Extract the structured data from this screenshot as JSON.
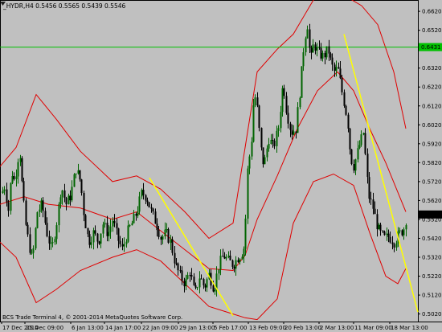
{
  "window": {
    "symbol_line": "_HYDR,H4  0.5456 0.5565 0.5439 0.5546",
    "copyright": "BCS Trade Terminal 4, © 2001-2014 MetaQuotes Software Corp."
  },
  "colors": {
    "background": "#c0c0c0",
    "bull_candle": "#006400",
    "bear_candle": "#000000",
    "bollinger": "#e00000",
    "trendline": "#ffff00",
    "hline": "#00c000",
    "last_price_tag": "#000000"
  },
  "price_axis": {
    "labels": [
      "0.6620",
      "0.6520",
      "0.6420",
      "0.6320",
      "0.6220",
      "0.6120",
      "0.6020",
      "0.5920",
      "0.5820",
      "0.5720",
      "0.5620",
      "0.5520",
      "0.5420",
      "0.5320",
      "0.5220",
      "0.5120",
      "0.5020"
    ],
    "hline_tag": "0.6431",
    "last_price_tag": "0.5546"
  },
  "time_axis": {
    "labels": [
      "17 Dec 2014",
      "25 Dec 09:00",
      "6 Jan 13:00",
      "14 Jan 17:00",
      "22 Jan 09:00",
      "29 Jan 13:00",
      "5 Feb 17:00",
      "13 Feb 09:00",
      "20 Feb 13:00",
      "2 Mar 13:00",
      "11 Mar 09:00",
      "18 Mar 13:00"
    ]
  },
  "chart_data": {
    "type": "candlestick",
    "symbol": "_HYDR",
    "timeframe": "H4",
    "ohlc_last": {
      "open": 0.5456,
      "high": 0.5565,
      "low": 0.5439,
      "close": 0.5546
    },
    "ylim": [
      0.5,
      0.668
    ],
    "horizontal_line": 0.6431,
    "price_path": [
      [
        0,
        0.564
      ],
      [
        6,
        0.57
      ],
      [
        10,
        0.556
      ],
      [
        14,
        0.578
      ],
      [
        18,
        0.572
      ],
      [
        24,
        0.59
      ],
      [
        28,
        0.565
      ],
      [
        32,
        0.548
      ],
      [
        36,
        0.538
      ],
      [
        40,
        0.53
      ],
      [
        46,
        0.556
      ],
      [
        52,
        0.56
      ],
      [
        58,
        0.545
      ],
      [
        64,
        0.535
      ],
      [
        70,
        0.55
      ],
      [
        76,
        0.57
      ],
      [
        82,
        0.56
      ],
      [
        88,
        0.565
      ],
      [
        94,
        0.579
      ],
      [
        100,
        0.572
      ],
      [
        104,
        0.555
      ],
      [
        110,
        0.54
      ],
      [
        116,
        0.545
      ],
      [
        122,
        0.54
      ],
      [
        128,
        0.55
      ],
      [
        134,
        0.544
      ],
      [
        140,
        0.552
      ],
      [
        146,
        0.542
      ],
      [
        152,
        0.536
      ],
      [
        158,
        0.545
      ],
      [
        164,
        0.55
      ],
      [
        170,
        0.556
      ],
      [
        176,
        0.566
      ],
      [
        182,
        0.564
      ],
      [
        188,
        0.556
      ],
      [
        194,
        0.55
      ],
      [
        200,
        0.542
      ],
      [
        206,
        0.545
      ],
      [
        212,
        0.54
      ],
      [
        218,
        0.528
      ],
      [
        224,
        0.522
      ],
      [
        230,
        0.518
      ],
      [
        236,
        0.525
      ],
      [
        242,
        0.512
      ],
      [
        248,
        0.522
      ],
      [
        254,
        0.516
      ],
      [
        260,
        0.523
      ],
      [
        266,
        0.515
      ],
      [
        272,
        0.528
      ],
      [
        278,
        0.533
      ],
      [
        284,
        0.53
      ],
      [
        290,
        0.528
      ],
      [
        296,
        0.532
      ],
      [
        300,
        0.534
      ],
      [
        304,
        0.538
      ],
      [
        308,
        0.58
      ],
      [
        312,
        0.59
      ],
      [
        316,
        0.62
      ],
      [
        320,
        0.61
      ],
      [
        324,
        0.59
      ],
      [
        328,
        0.58
      ],
      [
        334,
        0.595
      ],
      [
        340,
        0.59
      ],
      [
        346,
        0.6
      ],
      [
        352,
        0.625
      ],
      [
        356,
        0.61
      ],
      [
        362,
        0.598
      ],
      [
        368,
        0.6
      ],
      [
        374,
        0.625
      ],
      [
        378,
        0.645
      ],
      [
        382,
        0.656
      ],
      [
        386,
        0.635
      ],
      [
        390,
        0.645
      ],
      [
        396,
        0.64
      ],
      [
        402,
        0.638
      ],
      [
        408,
        0.642
      ],
      [
        412,
        0.634
      ],
      [
        416,
        0.63
      ],
      [
        420,
        0.632
      ],
      [
        426,
        0.618
      ],
      [
        432,
        0.605
      ],
      [
        436,
        0.585
      ],
      [
        440,
        0.58
      ],
      [
        446,
        0.59
      ],
      [
        452,
        0.598
      ],
      [
        458,
        0.565
      ],
      [
        464,
        0.558
      ],
      [
        468,
        0.55
      ],
      [
        472,
        0.545
      ],
      [
        478,
        0.542
      ],
      [
        484,
        0.543
      ],
      [
        490,
        0.54
      ],
      [
        496,
        0.544
      ],
      [
        502,
        0.547
      ],
      [
        506,
        0.5546
      ]
    ],
    "bands": {
      "upper": [
        [
          0,
          0.58
        ],
        [
          20,
          0.59
        ],
        [
          45,
          0.618
        ],
        [
          70,
          0.605
        ],
        [
          100,
          0.588
        ],
        [
          140,
          0.572
        ],
        [
          170,
          0.575
        ],
        [
          200,
          0.568
        ],
        [
          230,
          0.556
        ],
        [
          260,
          0.542
        ],
        [
          290,
          0.55
        ],
        [
          305,
          0.59
        ],
        [
          320,
          0.63
        ],
        [
          345,
          0.642
        ],
        [
          365,
          0.65
        ],
        [
          390,
          0.668
        ],
        [
          410,
          0.672
        ],
        [
          430,
          0.67
        ],
        [
          450,
          0.665
        ],
        [
          470,
          0.655
        ],
        [
          490,
          0.63
        ],
        [
          505,
          0.6
        ]
      ],
      "middle": [
        [
          0,
          0.56
        ],
        [
          30,
          0.564
        ],
        [
          60,
          0.56
        ],
        [
          100,
          0.558
        ],
        [
          140,
          0.552
        ],
        [
          170,
          0.556
        ],
        [
          200,
          0.546
        ],
        [
          230,
          0.536
        ],
        [
          260,
          0.526
        ],
        [
          290,
          0.525
        ],
        [
          305,
          0.533
        ],
        [
          320,
          0.552
        ],
        [
          345,
          0.575
        ],
        [
          370,
          0.6
        ],
        [
          395,
          0.62
        ],
        [
          420,
          0.63
        ],
        [
          440,
          0.62
        ],
        [
          460,
          0.6
        ],
        [
          480,
          0.582
        ],
        [
          505,
          0.556
        ]
      ],
      "lower": [
        [
          0,
          0.54
        ],
        [
          20,
          0.532
        ],
        [
          45,
          0.508
        ],
        [
          70,
          0.515
        ],
        [
          100,
          0.525
        ],
        [
          140,
          0.532
        ],
        [
          170,
          0.536
        ],
        [
          200,
          0.53
        ],
        [
          230,
          0.518
        ],
        [
          260,
          0.506
        ],
        [
          290,
          0.502
        ],
        [
          305,
          0.5
        ],
        [
          320,
          0.499
        ],
        [
          345,
          0.51
        ],
        [
          365,
          0.55
        ],
        [
          390,
          0.572
        ],
        [
          415,
          0.576
        ],
        [
          440,
          0.57
        ],
        [
          460,
          0.545
        ],
        [
          480,
          0.522
        ],
        [
          495,
          0.518
        ],
        [
          505,
          0.526
        ]
      ]
    },
    "trendlines": [
      {
        "from": [
          186,
          0.574
        ],
        "to": [
          290,
          0.501
        ]
      },
      {
        "from": [
          428,
          0.65
        ],
        "to": [
          520,
          0.503
        ]
      }
    ]
  }
}
